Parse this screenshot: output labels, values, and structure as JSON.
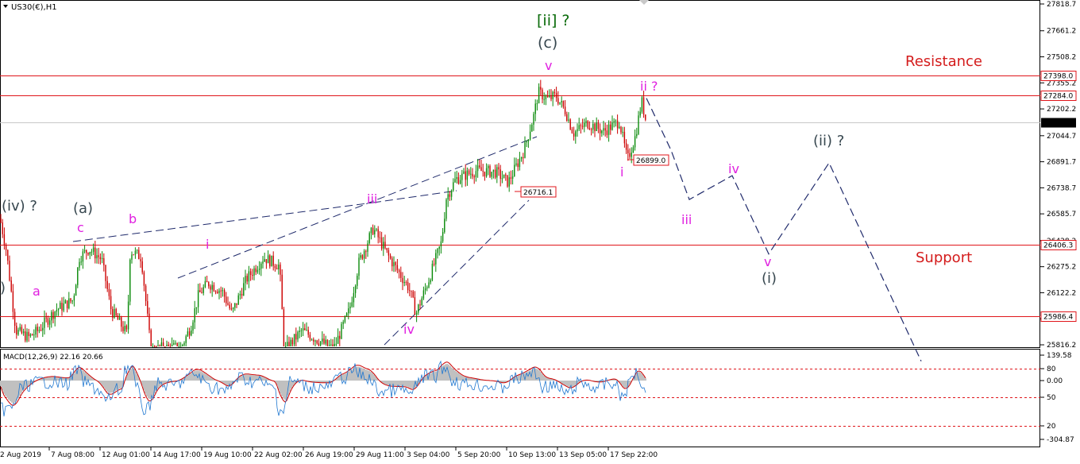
{
  "symbol": "US30(€),H1",
  "colors": {
    "bull": "#0a8a0a",
    "bear": "#cc0000",
    "level": "#e0161b",
    "wave_pink": "#e020e0",
    "wave_slate": "#37474f",
    "wave_green": "#0a6b0a",
    "trend": "#1f2a6b",
    "macd_line": "#1f77d0",
    "macd_signal": "#cc0000",
    "macd_hist": "#c0c0c0"
  },
  "chart_data": [
    {
      "type": "line",
      "title": "US30(€),H1",
      "y_ticks": [
        "27818.7",
        "27661.2",
        "27508.2",
        "27355.2",
        "27202.2",
        "27044.7",
        "26891.7",
        "26738.7",
        "26585.7",
        "26428.2",
        "26275.2",
        "26122.2",
        "25969.2",
        "25816.2"
      ],
      "y_range": [
        25780,
        27870
      ],
      "x_ticks": [
        "2 Aug 2019",
        "7 Aug 08:00",
        "12 Aug 01:00",
        "14 Aug 17:00",
        "19 Aug 10:00",
        "22 Aug 02:00",
        "26 Aug 19:00",
        "29 Aug 11:00",
        "3 Sep 04:00",
        "5 Sep 20:00",
        "10 Sep 13:00",
        "13 Sep 05:00",
        "17 Sep 22:00"
      ],
      "price_path": [
        [
          0,
          26560
        ],
        [
          8,
          26370
        ],
        [
          20,
          25900
        ],
        [
          36,
          25860
        ],
        [
          48,
          25900
        ],
        [
          70,
          26020
        ],
        [
          92,
          26080
        ],
        [
          100,
          26330
        ],
        [
          112,
          26380
        ],
        [
          128,
          26320
        ],
        [
          140,
          26020
        ],
        [
          160,
          25880
        ],
        [
          164,
          26370
        ],
        [
          178,
          26330
        ],
        [
          190,
          25780
        ],
        [
          205,
          25800
        ],
        [
          228,
          25800
        ],
        [
          240,
          25920
        ],
        [
          250,
          26110
        ],
        [
          262,
          26180
        ],
        [
          280,
          26130
        ],
        [
          292,
          26000
        ],
        [
          310,
          26200
        ],
        [
          332,
          26330
        ],
        [
          352,
          26280
        ],
        [
          358,
          25780
        ],
        [
          380,
          25900
        ],
        [
          420,
          25790
        ],
        [
          440,
          26020
        ],
        [
          452,
          26300
        ],
        [
          470,
          26500
        ],
        [
          490,
          26330
        ],
        [
          515,
          26150
        ],
        [
          524,
          26000
        ],
        [
          540,
          26200
        ],
        [
          556,
          26420
        ],
        [
          562,
          26680
        ],
        [
          574,
          26790
        ],
        [
          600,
          26840
        ],
        [
          625,
          26830
        ],
        [
          640,
          26770
        ],
        [
          660,
          26960
        ],
        [
          672,
          27160
        ],
        [
          678,
          27300
        ],
        [
          690,
          27260
        ],
        [
          700,
          27280
        ],
        [
          712,
          27190
        ],
        [
          722,
          27060
        ],
        [
          740,
          27120
        ],
        [
          760,
          27070
        ],
        [
          780,
          27130
        ],
        [
          790,
          26900
        ],
        [
          800,
          27040
        ],
        [
          808,
          27250
        ],
        [
          814,
          27120
        ]
      ],
      "horizontal_levels": [
        {
          "value": 27398.0,
          "label": "27398.0"
        },
        {
          "value": 27284.0,
          "label": "27284.0"
        },
        {
          "value": 26406.3,
          "label": "26406.3"
        },
        {
          "value": 25986.4,
          "label": "25986.4"
        }
      ],
      "current_price": {
        "value": 27119.7,
        "label": "27119.7"
      },
      "price_labels": [
        {
          "value": 26899.0,
          "label": "26899.0"
        },
        {
          "value": 26716.1,
          "label": "26716.1"
        }
      ],
      "projection": [
        [
          814,
          27265
        ],
        [
          845,
          26960
        ],
        [
          868,
          26670
        ],
        [
          922,
          26810
        ],
        [
          968,
          26350
        ],
        [
          1044,
          26885
        ],
        [
          1160,
          25720
        ]
      ],
      "annotations": {
        "resistance": "Resistance",
        "support": "Support",
        "wave_ii_major": "[ii] ?",
        "wave_c_paren": "(c)",
        "wave_v_top": "v",
        "wave_ii_q": "ii ?",
        "wave_i": "i",
        "wave_iii_proj": "iii",
        "wave_iv_proj": "iv",
        "wave_v_proj": "v",
        "wave_i_paren": "(i)",
        "wave_ii_paren_q": "(ii) ?",
        "wave_iv_paren_q": "(iv) ?",
        "wave_a_paren": "(a)",
        "wave_c_small": "c",
        "wave_b_small": "b",
        "wave_a_small": "a",
        "wave_i_small": "i",
        "wave_iii_small": "iii",
        "wave_iv_small": "iv",
        "wave_edge_paren": ")"
      }
    },
    {
      "type": "line",
      "title": "MACD(12,26,9) 22.16 20.66",
      "indicator": "MACD(12,26,9)",
      "values": [
        "22.16",
        "20.66"
      ],
      "y_ticks": [
        "139.58",
        "80",
        "0.00",
        "50",
        "20",
        "-304.87"
      ],
      "dashed_levels": [
        "80",
        "50",
        "20"
      ]
    }
  ]
}
